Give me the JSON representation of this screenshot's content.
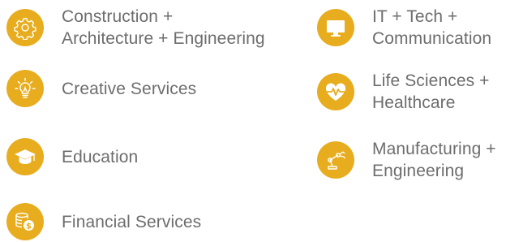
{
  "colors": {
    "accent": "#e8ad1f",
    "text": "#6d6d6d"
  },
  "industries": [
    {
      "label": "Construction +\nArchitecture + Engineering",
      "icon": "gear-icon"
    },
    {
      "label": "Creative Services",
      "icon": "lightbulb-icon"
    },
    {
      "label": "Education",
      "icon": "graduation-cap-icon"
    },
    {
      "label": "Financial Services",
      "icon": "coins-icon"
    },
    {
      "label": "IT + Tech +\nCommunication",
      "icon": "monitor-icon"
    },
    {
      "label": "Life Sciences +\nHealthcare",
      "icon": "heartbeat-icon"
    },
    {
      "label": "Manufacturing +\nEngineering",
      "icon": "robot-arm-icon"
    }
  ]
}
